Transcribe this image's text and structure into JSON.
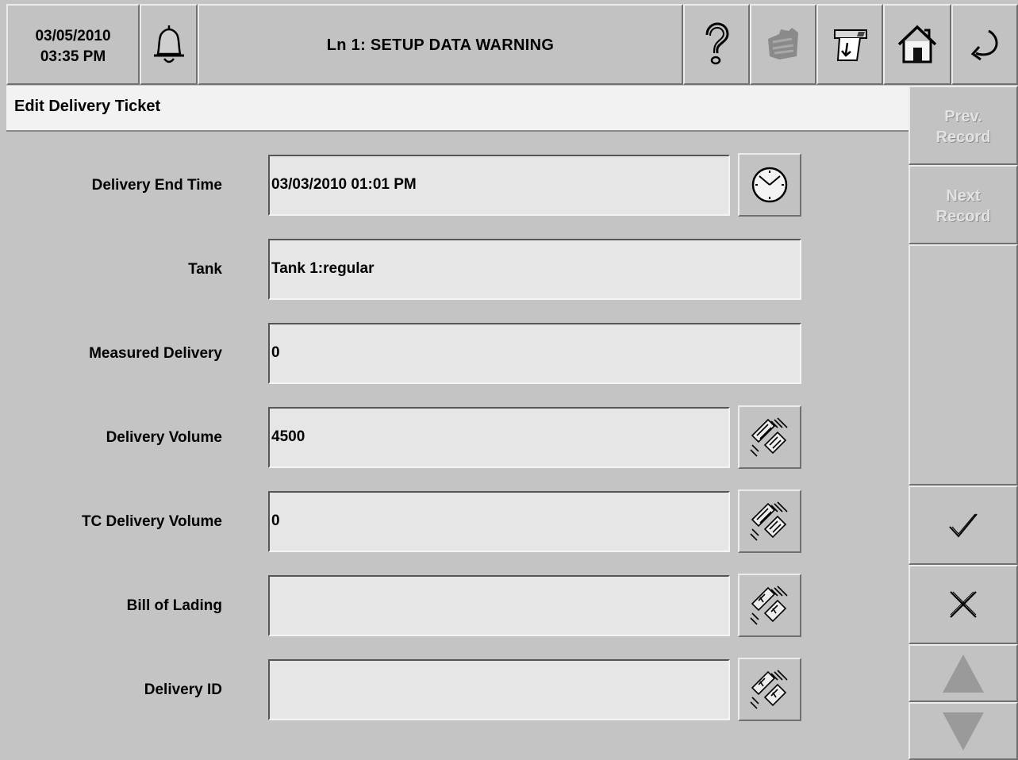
{
  "header": {
    "date": "03/05/2010",
    "time": "03:35 PM",
    "alarm_message": "Ln 1: SETUP DATA WARNING",
    "icons": [
      "bell-icon",
      "help-icon",
      "printer-icon",
      "report-icon",
      "home-icon",
      "back-icon"
    ]
  },
  "page": {
    "title": "Edit Delivery Ticket"
  },
  "form": {
    "delivery_end_time": {
      "label": "Delivery End Time",
      "value": "03/03/2010 01:01 PM"
    },
    "tank": {
      "label": "Tank",
      "value": "Tank 1:regular"
    },
    "measured_delivery": {
      "label": "Measured Delivery",
      "value": "0"
    },
    "delivery_volume": {
      "label": "Delivery Volume",
      "value": "4500"
    },
    "tc_delivery_volume": {
      "label": "TC Delivery Volume",
      "value": "0"
    },
    "bill_of_lading": {
      "label": "Bill of Lading",
      "value": ""
    },
    "delivery_id": {
      "label": "Delivery ID",
      "value": ""
    }
  },
  "sidebar": {
    "prev_record": [
      "Prev.",
      "Record"
    ],
    "next_record": [
      "Next",
      "Record"
    ],
    "accept_icon": "checkmark-icon",
    "cancel_icon": "x-icon",
    "scroll_up_icon": "triangle-up-icon",
    "scroll_down_icon": "triangle-down-icon"
  },
  "colors": {
    "panel": "#c4c4c4",
    "field": "#e6e6e6",
    "title_bar": "#f2f2f2",
    "disabled_text": "#e2e2e2"
  }
}
